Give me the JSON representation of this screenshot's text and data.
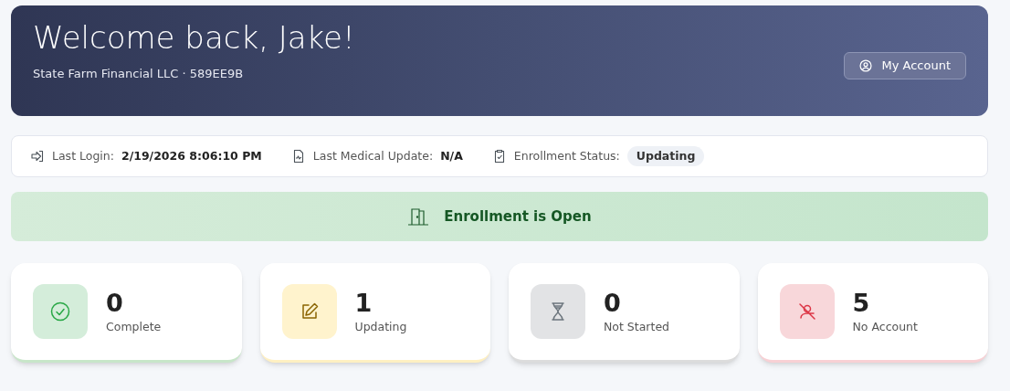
{
  "header": {
    "title": "Welcome back, Jake!",
    "subtitle": "State Farm Financial LLC · 589EE9B",
    "account_button": "My Account"
  },
  "info_bar": [
    {
      "kind": "login",
      "label": "Last Login:",
      "value": "2/19/2026 8:06:10 PM"
    },
    {
      "kind": "medical",
      "label": "Last Medical Update:",
      "value": "N/A"
    },
    {
      "kind": "status",
      "label": "Enrollment Status:",
      "badge": "Updating"
    }
  ],
  "banner": {
    "text": "Enrollment is Open"
  },
  "stats": [
    {
      "kind": "complete",
      "count": "0",
      "label": "Complete"
    },
    {
      "kind": "updating",
      "count": "1",
      "label": "Updating"
    },
    {
      "kind": "not_started",
      "count": "0",
      "label": "Not Started"
    },
    {
      "kind": "no_account",
      "count": "5",
      "label": "No Account"
    }
  ]
}
